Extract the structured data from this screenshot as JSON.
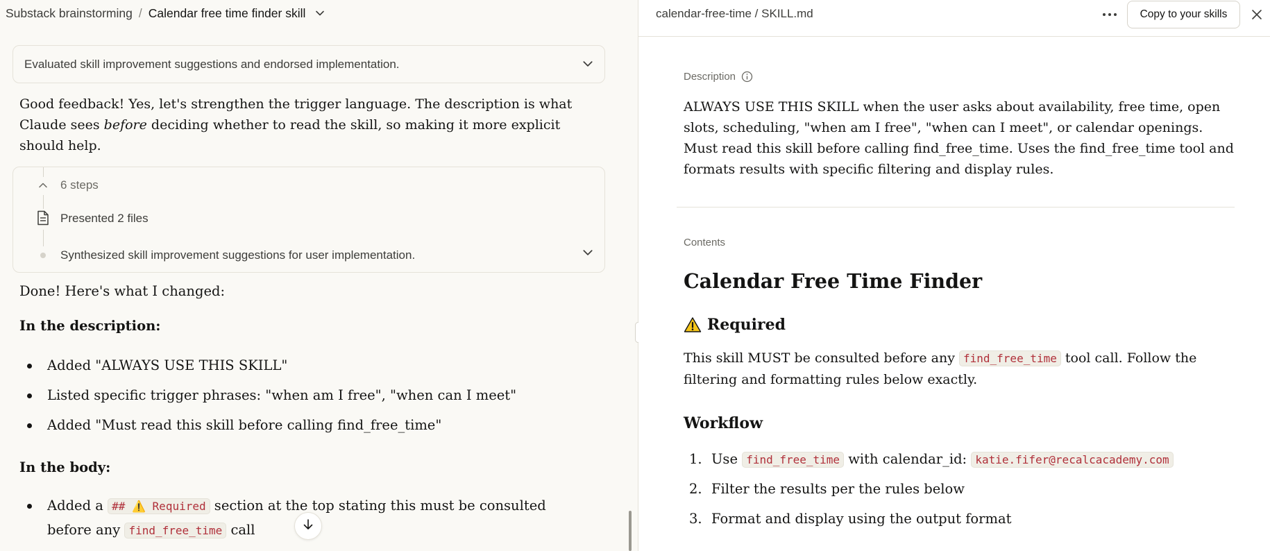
{
  "header": {
    "project": "Substack brainstorming",
    "separator": "/",
    "chat_title": "Calendar free time finder skill"
  },
  "left": {
    "thinking_summary": "Evaluated skill improvement suggestions and endorsed implementation.",
    "reply_para_1a": "Good feedback! Yes, let's strengthen the trigger language. The description is what Claude sees ",
    "reply_para_1_em": "before",
    "reply_para_1b": " deciding whether to read the skill, so making it more explicit should help.",
    "steps": {
      "count_label": "6 steps",
      "presented_label": "Presented 2 files",
      "synth_label": "Synthesized skill improvement suggestions for user implementation."
    },
    "done_text": "Done! Here's what I changed:",
    "desc_heading": "In the description:",
    "desc_bullets": [
      "Added \"ALWAYS USE THIS SKILL\"",
      "Listed specific trigger phrases: \"when am I free\", \"when can I meet\"",
      "Added \"Must read this skill before calling find_free_time\""
    ],
    "body_heading": "In the body:",
    "body_bullet_prefix": "Added a ",
    "body_bullet_code1": "## ⚠️ Required",
    "body_bullet_mid": " section at the top stating this must be consulted before any ",
    "body_bullet_code2": "find_free_time",
    "body_bullet_suffix": " call"
  },
  "right": {
    "path": "calendar-free-time / SKILL.md",
    "copy_button": "Copy to your skills",
    "description_label": "Description",
    "description_text": "ALWAYS USE THIS SKILL when the user asks about availability, free time, open slots, scheduling, \"when am I free\", \"when can I meet\", or calendar openings. Must read this skill before calling find_free_time. Uses the find_free_time tool and formats results with specific filtering and display rules.",
    "contents_label": "Contents",
    "title": "Calendar Free Time Finder",
    "required_heading": "Required",
    "required_pre": "This skill MUST be consulted before any ",
    "required_code": "find_free_time",
    "required_post": " tool call. Follow the filtering and formatting rules below exactly.",
    "workflow_heading": "Workflow",
    "workflow": {
      "n1": "1.",
      "s1_pre": "Use ",
      "s1_code1": "find_free_time",
      "s1_mid": " with calendar_id: ",
      "s1_code2": "katie.fifer@recalcacademy.com",
      "n2": "2.",
      "s2": "Filter the results per the rules below",
      "n3": "3.",
      "s3": "Format and display using the output format"
    }
  },
  "colors": {
    "background": "#faf9f5",
    "panel": "#ffffff",
    "border": "#e5e2d9",
    "code_text": "#b0303a",
    "code_bg": "#f0eee6"
  },
  "icons": [
    "chevron-down-icon",
    "file-icon",
    "chevron-up-icon",
    "arrow-down-icon",
    "more-icon",
    "close-icon",
    "info-icon",
    "warning-icon"
  ]
}
